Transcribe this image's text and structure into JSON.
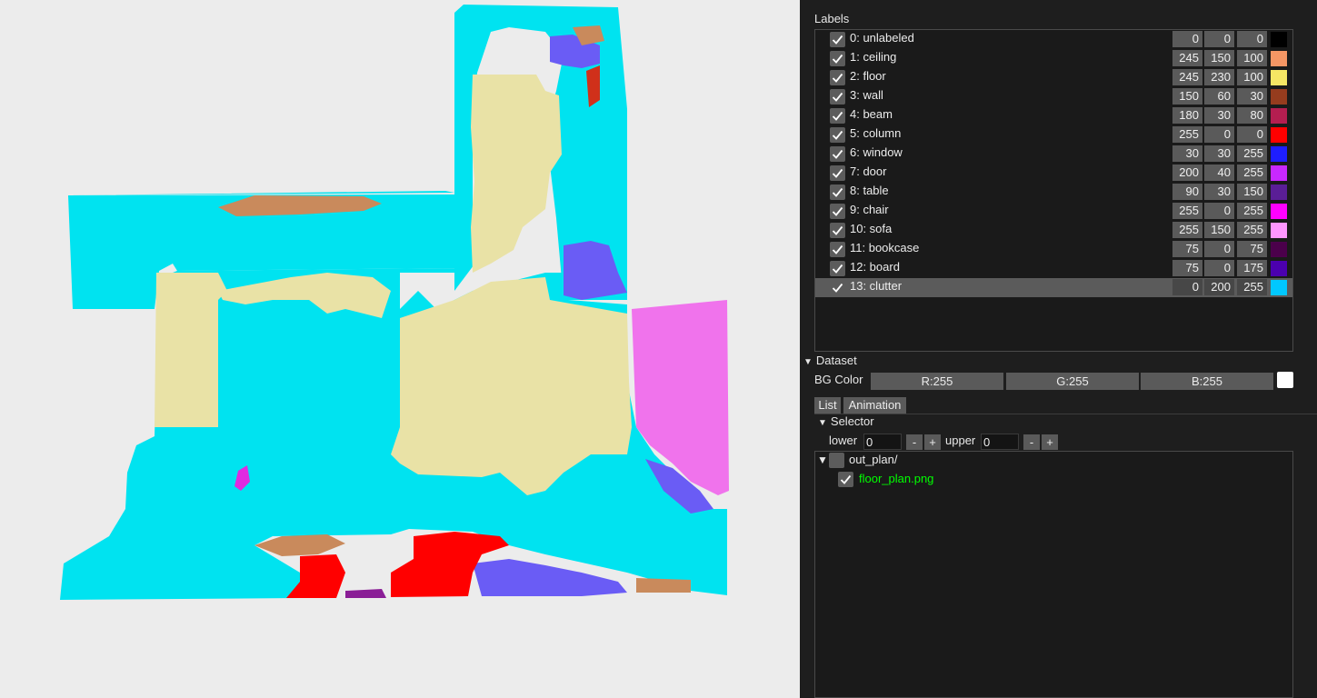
{
  "labels_panel": {
    "title": "Labels",
    "items": [
      {
        "name": "0: unlabeled",
        "r": "0",
        "g": "0",
        "b": "0",
        "color": "#000000",
        "checked": true
      },
      {
        "name": "1: ceiling",
        "r": "245",
        "g": "150",
        "b": "100",
        "color": "#f59664",
        "checked": true
      },
      {
        "name": "2: floor",
        "r": "245",
        "g": "230",
        "b": "100",
        "color": "#f5e664",
        "checked": true
      },
      {
        "name": "3: wall",
        "r": "150",
        "g": "60",
        "b": "30",
        "color": "#963c1e",
        "checked": true
      },
      {
        "name": "4: beam",
        "r": "180",
        "g": "30",
        "b": "80",
        "color": "#b41e50",
        "checked": true
      },
      {
        "name": "5: column",
        "r": "255",
        "g": "0",
        "b": "0",
        "color": "#ff0000",
        "checked": true
      },
      {
        "name": "6: window",
        "r": "30",
        "g": "30",
        "b": "255",
        "color": "#1e1eff",
        "checked": true
      },
      {
        "name": "7: door",
        "r": "200",
        "g": "40",
        "b": "255",
        "color": "#c828ff",
        "checked": true
      },
      {
        "name": "8: table",
        "r": "90",
        "g": "30",
        "b": "150",
        "color": "#5a1e96",
        "checked": true
      },
      {
        "name": "9: chair",
        "r": "255",
        "g": "0",
        "b": "255",
        "color": "#ff00ff",
        "checked": true
      },
      {
        "name": "10: sofa",
        "r": "255",
        "g": "150",
        "b": "255",
        "color": "#ff96ff",
        "checked": true
      },
      {
        "name": "11: bookcase",
        "r": "75",
        "g": "0",
        "b": "75",
        "color": "#4b004b",
        "checked": true
      },
      {
        "name": "12: board",
        "r": "75",
        "g": "0",
        "b": "175",
        "color": "#4b00af",
        "checked": true
      },
      {
        "name": "13: clutter",
        "r": "0",
        "g": "200",
        "b": "255",
        "color": "#00c8ff",
        "checked": true,
        "selected": true
      }
    ]
  },
  "dataset": {
    "title": "Dataset",
    "bg_color_label": "BG Color",
    "r_label": "R:255",
    "g_label": "G:255",
    "b_label": "B:255",
    "bg_color": "#ffffff"
  },
  "tabs": {
    "list": "List",
    "animation": "Animation"
  },
  "selector": {
    "title": "Selector",
    "lower_label": "lower",
    "lower_value": "0",
    "upper_label": "upper",
    "upper_value": "0",
    "minus": "-",
    "plus": "+"
  },
  "file_tree": {
    "folder": "out_plan/",
    "folder_checked": false,
    "file": "floor_plan.png",
    "file_checked": true,
    "file_color": "#00ff00"
  }
}
